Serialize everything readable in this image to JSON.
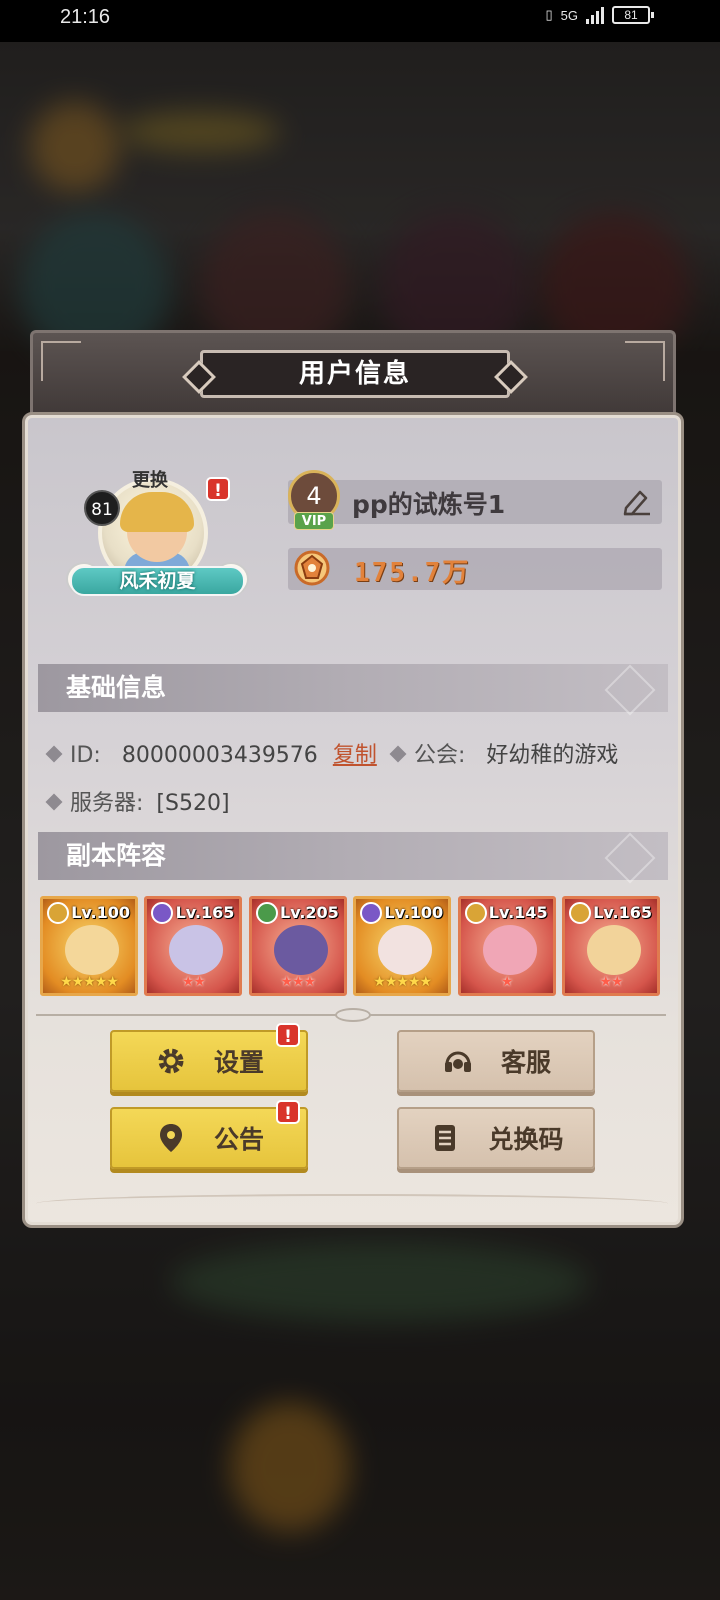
{
  "status_bar": {
    "time": "21:16",
    "battery": "81",
    "network": "5G"
  },
  "dialog": {
    "title": "用户信息",
    "avatar": {
      "change_label": "更换",
      "level": "81",
      "title_banner": "风禾初夏"
    },
    "vip": {
      "level": "4",
      "tag": "VIP"
    },
    "player_name": "pp的试炼号1",
    "power": "175.7万",
    "basic_info": {
      "header": "基础信息",
      "id_label": "ID:",
      "id_value": "80000003439576",
      "copy_label": "复制",
      "guild_label": "公会:",
      "guild_value": "好幼稚的游戏",
      "server_label": "服务器:",
      "server_value": "[S520]"
    },
    "lineup": {
      "header": "副本阵容",
      "heroes": [
        {
          "level": "Lv.100",
          "stars": "★★★★★",
          "frame": "gold",
          "element": "gold",
          "star_color": "gold"
        },
        {
          "level": "Lv.165",
          "stars": "★★",
          "frame": "red",
          "element": "purple",
          "star_color": "red"
        },
        {
          "level": "Lv.205",
          "stars": "★★★",
          "frame": "red",
          "element": "green",
          "star_color": "red"
        },
        {
          "level": "Lv.100",
          "stars": "★★★★★",
          "frame": "gold",
          "element": "purple",
          "star_color": "gold"
        },
        {
          "level": "Lv.145",
          "stars": "★",
          "frame": "red",
          "element": "gold",
          "star_color": "red"
        },
        {
          "level": "Lv.165",
          "stars": "★★",
          "frame": "red",
          "element": "gold",
          "star_color": "red"
        }
      ]
    },
    "buttons": {
      "settings": "设置",
      "support": "客服",
      "notice": "公告",
      "redeem": "兑换码"
    },
    "alert_mark": "!"
  },
  "colors": {
    "accent_orange": "#e2823b",
    "copy_link": "#c0532e",
    "yellow_button": "#f4d857",
    "beige_button": "#e3d2c0",
    "alert_red": "#d9342b"
  }
}
